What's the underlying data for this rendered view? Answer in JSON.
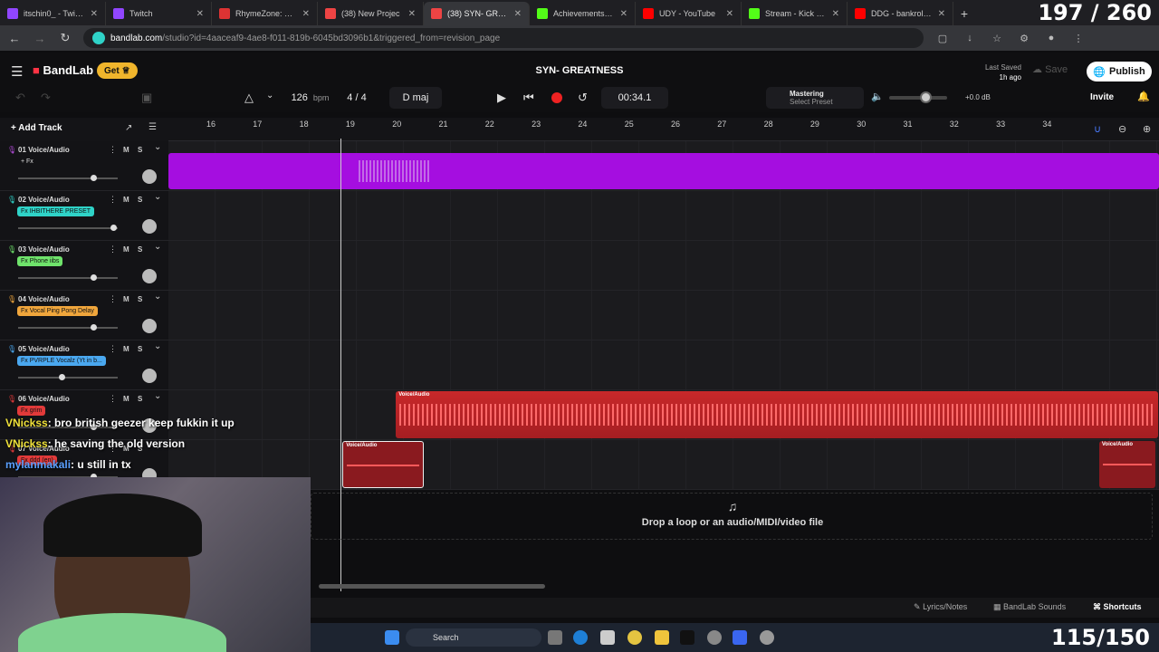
{
  "browser": {
    "tabs": [
      {
        "title": "itschin0_ - Twitch",
        "color": "#9146ff"
      },
      {
        "title": "Twitch",
        "color": "#9146ff"
      },
      {
        "title": "RhymeZone: ON ne",
        "color": "#d33"
      },
      {
        "title": "(38) New Projec",
        "color": "#e44"
      },
      {
        "title": "(38) SYN- GREA",
        "color": "#e44",
        "active": true
      },
      {
        "title": "Achievements - Kic",
        "color": "#53fc18"
      },
      {
        "title": "UDY - YouTube",
        "color": "#f00"
      },
      {
        "title": "Stream - Kick Dash",
        "color": "#53fc18"
      },
      {
        "title": "DDG - bankroll (Of",
        "color": "#f00"
      }
    ],
    "overlay_count": "197 / 260",
    "url_host": "bandlab.com",
    "url_path": "/studio?id=4aaceaf9-4ae8-f011-819b-6045bd3096b1&triggered_from=revision_page"
  },
  "app": {
    "logo": "BandLab",
    "get_label": "Get",
    "project_title": "SYN- GREATNESS",
    "last_saved_label": "Last Saved",
    "last_saved_time": "1h ago",
    "save_label": "Save",
    "publish_label": "Publish"
  },
  "transport": {
    "bpm": "126",
    "bpm_unit": "bpm",
    "time_sig": "4 / 4",
    "key": "D maj",
    "time": "00:34.1",
    "mastering_label": "Mastering",
    "mastering_preset": "Select Preset",
    "volume_db": "+0.0 dB",
    "volume_level": 0.62,
    "invite_label": "Invite"
  },
  "timeline": {
    "add_track_label": "Add Track",
    "ruler_ticks": [
      "16",
      "17",
      "18",
      "19",
      "20",
      "21",
      "22",
      "23",
      "24",
      "25",
      "26",
      "27",
      "28",
      "29",
      "30",
      "31",
      "32",
      "33",
      "34"
    ],
    "playhead_bar": 18.8
  },
  "tracks": [
    {
      "name": "01 Voice/Audio",
      "fx": "+ Fx",
      "fx_color": "transparent",
      "mic_color": "#b04bd6",
      "fader": 0.75
    },
    {
      "name": "02 Voice/Audio",
      "fx": "Fx IHBITHERE PRESET",
      "fx_color": "#2fd3c8",
      "mic_color": "#2fd3c8",
      "fader": 0.95
    },
    {
      "name": "03 Voice/Audio",
      "fx": "Fx Phone iibs",
      "fx_color": "#6fe36b",
      "mic_color": "#6fe36b",
      "fader": 0.75
    },
    {
      "name": "04 Voice/Audio",
      "fx": "Fx Vocal Ping Pong Delay",
      "fx_color": "#f0a63c",
      "mic_color": "#f0a63c",
      "fader": 0.75
    },
    {
      "name": "05 Voice/Audio",
      "fx": "Fx PVRPLE Vocalz (Yt in b...",
      "fx_color": "#4aa8f0",
      "mic_color": "#4aa8f0",
      "fader": 0.44
    },
    {
      "name": "06 Voice/Audio",
      "fx": "Fx grim",
      "fx_color": "#e23a3a",
      "mic_color": "#e23a3a",
      "fader": 0.75
    },
    {
      "name": "07 Voice/Audio",
      "fx": "Fx ddd (en)",
      "fx_color": "#e23a3a",
      "mic_color": "#e23a3a",
      "fader": 0.75
    }
  ],
  "track_buttons": {
    "mute": "M",
    "solo": "S"
  },
  "clip_label": "Voice/Audio",
  "drop_text": "Drop a loop or an audio/MIDI/video file",
  "bottom_bar": {
    "lyrics": "Lyrics/Notes",
    "sounds": "BandLab Sounds",
    "shortcuts": "Shortcuts"
  },
  "taskbar": {
    "search": "Search",
    "stream_count": "115/150"
  },
  "chat": [
    {
      "user": "VNickss",
      "msg": ": bro british geezer keep fukkin it up"
    },
    {
      "user": "VNickss",
      "msg": ": he saving the old version"
    },
    {
      "user": "mylanmakali",
      "msg": ": u still in tx"
    }
  ]
}
